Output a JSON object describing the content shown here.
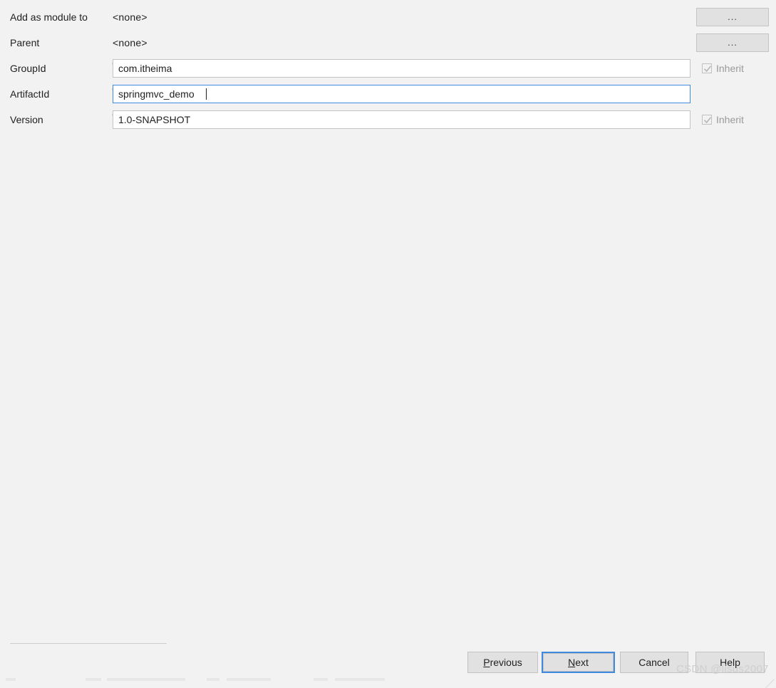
{
  "dialog": {
    "background_color": "#f2f2f2",
    "accent_color": "#3d8adf",
    "rows": [
      {
        "label": "Add as module to",
        "value": "<none>",
        "kind": "static"
      },
      {
        "label": "Parent",
        "value": "<none>",
        "kind": "static"
      },
      {
        "label": "GroupId",
        "value": "com.itheima",
        "kind": "input",
        "focused": false
      },
      {
        "label": "ArtifactId",
        "value": "springmvc_demo",
        "kind": "input",
        "focused": true
      },
      {
        "label": "Version",
        "value": "1.0-SNAPSHOT",
        "kind": "input",
        "focused": false
      }
    ],
    "browse_buttons": [
      {
        "label": "...",
        "icon": "ellipsis-icon"
      },
      {
        "label": "...",
        "icon": "ellipsis-icon"
      }
    ],
    "inherit_checkboxes": [
      {
        "label": "Inherit",
        "checked": true,
        "enabled": false
      },
      {
        "label": "Inherit",
        "checked": true,
        "enabled": false
      }
    ]
  },
  "buttons": {
    "previous": {
      "label": "Previous",
      "mnemonic": "P",
      "before": "",
      "after": "revious",
      "focused": false
    },
    "next": {
      "label": "Next",
      "mnemonic": "N",
      "before": "",
      "after": "ext",
      "focused": true
    },
    "cancel": {
      "label": "Cancel",
      "focused": false
    },
    "help": {
      "label": "Help",
      "focused": false
    }
  },
  "watermark": {
    "text": "CSDN @lisus2007"
  }
}
